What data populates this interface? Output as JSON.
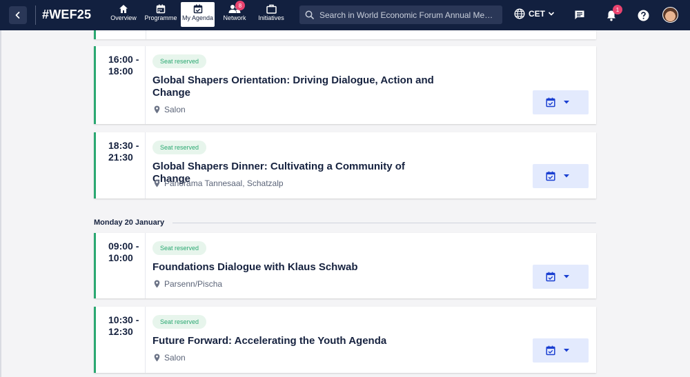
{
  "header": {
    "brand": "#WEF25",
    "nav": [
      {
        "label": "Overview",
        "icon": "home-icon",
        "active": false,
        "badge": null
      },
      {
        "label": "Programme",
        "icon": "calendar-icon",
        "active": false,
        "badge": null
      },
      {
        "label": "My Agenda",
        "icon": "calendar-check-icon",
        "active": true,
        "badge": null
      },
      {
        "label": "Network",
        "icon": "people-icon",
        "active": false,
        "badge": "8"
      },
      {
        "label": "Initiatives",
        "icon": "briefcase-icon",
        "active": false,
        "badge": null
      }
    ],
    "search": {
      "placeholder": "Search in World Economic Forum Annual Meeting ..."
    },
    "timezone": "CET",
    "notifications_badge": "1"
  },
  "sessions": [
    {
      "time": "16:00 -\n18:00",
      "badge": "Seat reserved",
      "title": "Global Shapers Orientation: Driving Dialogue, Action and Change",
      "location": "Salon"
    },
    {
      "time": "18:30 -\n21:30",
      "badge": "Seat reserved",
      "title": "Global Shapers Dinner: Cultivating a Community of Change",
      "location": "Panorama Tannesaal, Schatzalp"
    },
    {
      "time": "09:00 -\n10:00",
      "badge": "Seat reserved",
      "title": "Foundations Dialogue with Klaus Schwab",
      "location": "Parsenn/Pischa"
    },
    {
      "time": "10:30 -\n12:30",
      "badge": "Seat reserved",
      "title": "Future Forward: Accelerating the Youth Agenda",
      "location": "Salon"
    }
  ],
  "day_header": "Monday 20 January",
  "colors": {
    "navy": "#12203f",
    "accent_green": "#2aa871",
    "badge_pink": "#e8436f",
    "calendar_button_bg": "#e3eafd",
    "calendar_icon": "#1a3fd1"
  }
}
